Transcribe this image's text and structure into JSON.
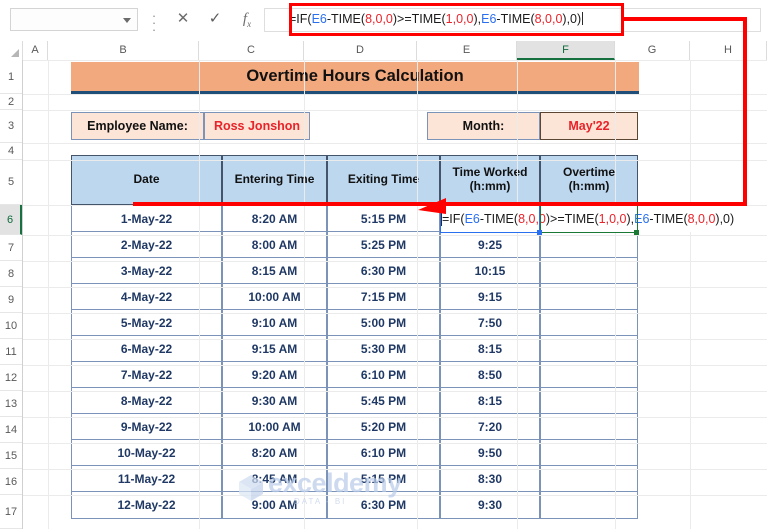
{
  "toolbar": {
    "name_box_value": "",
    "name_box_placeholder": "",
    "cancel_label": "✕",
    "enter_label": "✓",
    "fx_label": "f",
    "fx_sub": "x",
    "kebab_label": "⋮",
    "formula_value": "=IF(E6-TIME(8,0,0)>=TIME(1,0,0),E6-TIME(8,0,0),0)",
    "formula_tokens": [
      {
        "t": "=IF(",
        "c": "black"
      },
      {
        "t": "E6",
        "c": "blue"
      },
      {
        "t": "-TIME(",
        "c": "black"
      },
      {
        "t": "8,0,0",
        "c": "red"
      },
      {
        "t": ")>=TIME(",
        "c": "black"
      },
      {
        "t": "1,0,0",
        "c": "red"
      },
      {
        "t": "),",
        "c": "black"
      },
      {
        "t": "E6",
        "c": "blue"
      },
      {
        "t": "-TIME(",
        "c": "black"
      },
      {
        "t": "8,0,0",
        "c": "red"
      },
      {
        "t": "),0)",
        "c": "black"
      }
    ]
  },
  "grid": {
    "column_headers": [
      "A",
      "B",
      "C",
      "D",
      "E",
      "F",
      "G",
      "H"
    ],
    "selected_column": "F",
    "row_headers": [
      "1",
      "2",
      "3",
      "4",
      "5",
      "6",
      "7",
      "8",
      "9",
      "10",
      "11",
      "12",
      "13",
      "14",
      "15",
      "16",
      "17"
    ],
    "selected_row": "6",
    "active_cell": "F6"
  },
  "sheet": {
    "title": "Overtime Hours Calculation",
    "employee_label": "Employee Name:",
    "employee_value": "Ross Jonshon",
    "month_label": "Month:",
    "month_value": "May'22",
    "table_headers": [
      {
        "line1": "Date",
        "line2": ""
      },
      {
        "line1": "Entering Time",
        "line2": ""
      },
      {
        "line1": "Exiting Time",
        "line2": ""
      },
      {
        "line1": "Time Worked",
        "line2": "(h:mm)"
      },
      {
        "line1": "Overtime",
        "line2": "(h:mm)"
      }
    ],
    "rows": [
      {
        "date": "1-May-22",
        "entering": "8:20 AM",
        "exiting": "5:15 PM",
        "worked": "",
        "overtime": ""
      },
      {
        "date": "2-May-22",
        "entering": "8:00 AM",
        "exiting": "5:25 PM",
        "worked": "9:25",
        "overtime": ""
      },
      {
        "date": "3-May-22",
        "entering": "8:15 AM",
        "exiting": "6:30 PM",
        "worked": "10:15",
        "overtime": ""
      },
      {
        "date": "4-May-22",
        "entering": "10:00 AM",
        "exiting": "7:15 PM",
        "worked": "9:15",
        "overtime": ""
      },
      {
        "date": "5-May-22",
        "entering": "9:10 AM",
        "exiting": "5:00 PM",
        "worked": "7:50",
        "overtime": ""
      },
      {
        "date": "6-May-22",
        "entering": "9:15 AM",
        "exiting": "5:30 PM",
        "worked": "8:15",
        "overtime": ""
      },
      {
        "date": "7-May-22",
        "entering": "9:20 AM",
        "exiting": "6:10 PM",
        "worked": "8:50",
        "overtime": ""
      },
      {
        "date": "8-May-22",
        "entering": "9:30 AM",
        "exiting": "5:45 PM",
        "worked": "8:15",
        "overtime": ""
      },
      {
        "date": "9-May-22",
        "entering": "10:00 AM",
        "exiting": "5:20 PM",
        "worked": "7:20",
        "overtime": ""
      },
      {
        "date": "10-May-22",
        "entering": "8:20 AM",
        "exiting": "6:10 PM",
        "worked": "9:50",
        "overtime": ""
      },
      {
        "date": "11-May-22",
        "entering": "8:45 AM",
        "exiting": "5:15 PM",
        "worked": "8:30",
        "overtime": ""
      },
      {
        "date": "12-May-22",
        "entering": "9:00 AM",
        "exiting": "6:30 PM",
        "worked": "9:30",
        "overtime": ""
      }
    ],
    "incell_formula": "=IF(E6-TIME(8,0,0)>=TIME(1,0,0),E6-TIME(8,0,0),0)"
  },
  "watermark": {
    "text": "exceldemy",
    "subtext": "DATA - BI"
  },
  "colors": {
    "title_fill": "#F2A97E",
    "title_underline": "#1F4E79",
    "info_fill": "#FCE4D6",
    "header_fill": "#BDD7EE",
    "data_text": "#1F3864",
    "value_text": "#E8232A",
    "annotation": "#FF0000",
    "selected_tab_green": "#15713F",
    "ref_blue": "#2A6FF0",
    "ref_green": "#1A7A34"
  }
}
